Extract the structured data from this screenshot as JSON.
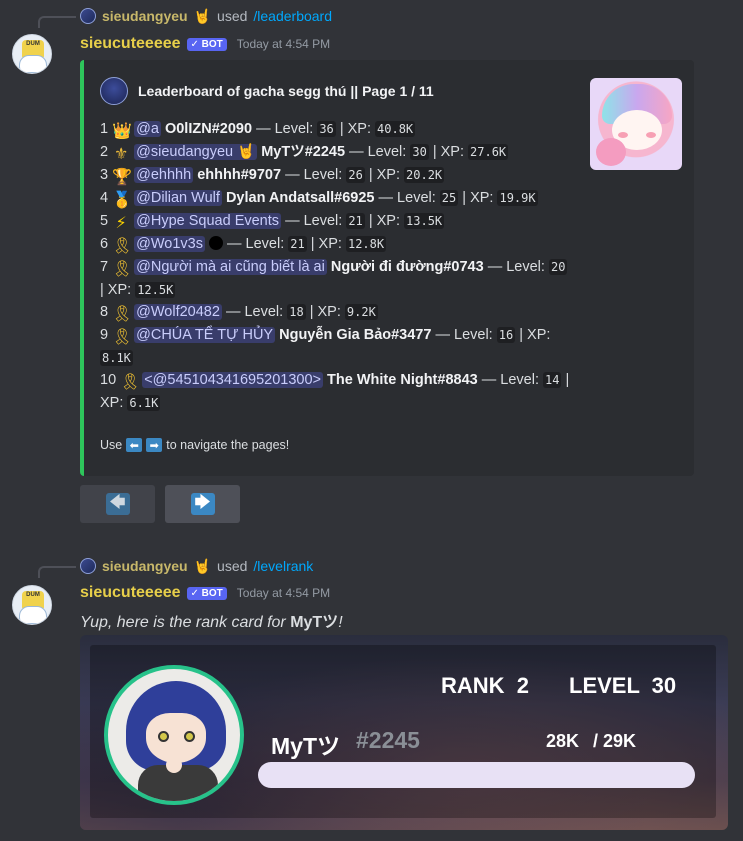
{
  "colors": {
    "background": "#313338",
    "embed_accent": "#2ec55b",
    "bot_tag": "#5865f2",
    "username": "#e7cf4a",
    "command_link": "#00a8fc",
    "avatar_ring": "#27c28a",
    "progress_fill": "#e8e1f5"
  },
  "message1": {
    "reply": {
      "user": "sieudangyeu",
      "emoji": "🤘",
      "used": "used",
      "command": "/leaderboard"
    },
    "author": "sieucuteeeee",
    "bot_tag": "✓ BOT",
    "timestamp": "Today at 4:54 PM",
    "embed": {
      "title": "Leaderboard of gacha segg thú || Page 1 / 11",
      "rows": [
        {
          "rank": "1",
          "emoji": "crown-icon",
          "glyph": "👑",
          "mention": "@a",
          "name": "O0lIZN#2090",
          "level_label": "— Level:",
          "level": "36",
          "xp_label": "| XP:",
          "xp": "40.8K"
        },
        {
          "rank": "2",
          "emoji": "hand-icon",
          "glyph": "⚜",
          "mention": "@sieudangyeu 🤘",
          "name": "MyTツ#2245",
          "level_label": "— Level:",
          "level": "30",
          "xp_label": "| XP:",
          "xp": "27.6K"
        },
        {
          "rank": "3",
          "emoji": "trophy-icon",
          "glyph": "🏆",
          "mention": "@ehhhh",
          "name": "ehhhh#9707",
          "level_label": "— Level:",
          "level": "26",
          "xp_label": "| XP:",
          "xp": "20.2K"
        },
        {
          "rank": "4",
          "emoji": "medal-icon",
          "glyph": "🥇",
          "mention": "@Dilian Wulf",
          "name": "Dylan Andatsall#6925",
          "level_label": "— Level:",
          "level": "25",
          "xp_label": "| XP:",
          "xp": "19.9K"
        },
        {
          "rank": "5",
          "emoji": "bolt-icon",
          "glyph": "⚡",
          "mention": "@Hype Squad Events",
          "name": "",
          "level_label": "— Level:",
          "level": "21",
          "xp_label": "| XP:",
          "xp": "13.5K"
        },
        {
          "rank": "6",
          "emoji": "ribbon-icon",
          "glyph": "🎗",
          "mention": "@Wo1v3s",
          "name": "",
          "level_label": "— Level:",
          "level": "21",
          "xp_label": "| XP:",
          "xp": "12.8K"
        },
        {
          "rank": "7",
          "emoji": "ribbon-icon",
          "glyph": "🎗",
          "mention": "@Người mà ai cũng biết là ai",
          "name": "Người đi đường#0743",
          "level_label": "— Level:",
          "level": "20",
          "xp_label": "| XP:",
          "xp": "12.5K"
        },
        {
          "rank": "8",
          "emoji": "ribbon-icon",
          "glyph": "🎗",
          "mention": "@Wolf20482",
          "name": "",
          "level_label": "— Level:",
          "level": "18",
          "xp_label": "| XP:",
          "xp": "9.2K"
        },
        {
          "rank": "9",
          "emoji": "ribbon-icon",
          "glyph": "🎗",
          "mention": "@CHÚA TỂ TỰ HỦY",
          "name": "Nguyễn Gia Bảo#3477",
          "level_label": "— Level:",
          "level": "16",
          "xp_label": "| XP:",
          "xp": "8.1K"
        },
        {
          "rank": "10",
          "emoji": "ribbon-icon",
          "glyph": "🎗",
          "mention": "<@545104341695201300>",
          "name": "The White Night#8843",
          "level_label": "— Level:",
          "level": "14",
          "xp_label": "| XP:",
          "xp": "6.1K"
        }
      ],
      "footer_pre": "Use",
      "footer_post": "to navigate the pages!"
    },
    "buttons": {
      "prev": "🡄",
      "next": "🡆"
    }
  },
  "message2": {
    "reply": {
      "user": "sieudangyeu",
      "emoji": "🤘",
      "used": "used",
      "command": "/levelrank"
    },
    "author": "sieucuteeeee",
    "bot_tag": "✓ BOT",
    "timestamp": "Today at 4:54 PM",
    "text_pre": "Yup, here is the rank card for ",
    "text_bold": "MyTツ",
    "text_post": "!",
    "card": {
      "rank_label": "RANK",
      "rank": "2",
      "level_label": "LEVEL",
      "level": "30",
      "username": "MyTツ",
      "discriminator": "#2245",
      "xp_current": "28K",
      "xp_total": "/ 29K",
      "progress": 0.965
    }
  }
}
